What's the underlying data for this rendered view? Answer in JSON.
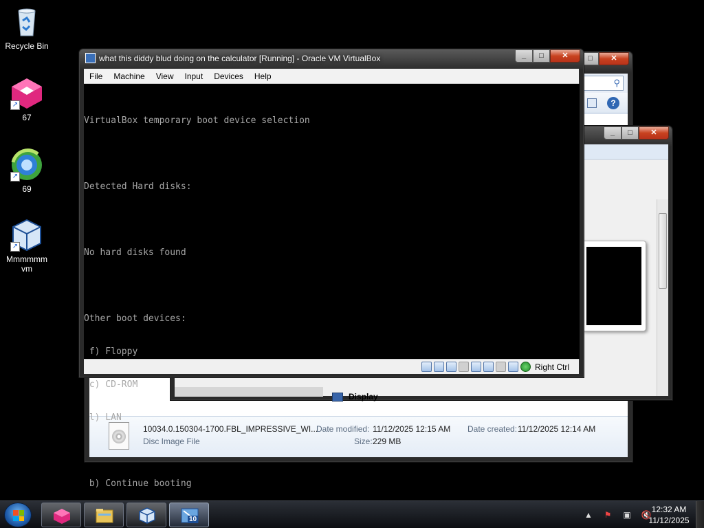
{
  "desktop": {
    "icons": [
      {
        "label": "Recycle Bin",
        "icon": "recycle-bin-icon"
      },
      {
        "label": "67",
        "icon": "pink-app-icon"
      },
      {
        "label": "69",
        "icon": "globe-app-icon"
      },
      {
        "label": "Mmmmmm vm",
        "icon": "virtualbox-icon"
      }
    ]
  },
  "explorer": {
    "file_name": "10034.0.150304-1700.FBL_IMPRESSIVE_WI...",
    "file_type": "Disc Image File",
    "date_modified_label": "Date modified:",
    "date_modified": "11/12/2025 12:15 AM",
    "date_created_label": "Date created:",
    "date_created": "11/12/2025 12:14 AM",
    "size_label": "Size:",
    "size": "229 MB"
  },
  "settings": {
    "display_label": "Display"
  },
  "vbox": {
    "title": "what this diddy blud doing on the calculator [Running] - Oracle VM VirtualBox",
    "menu": [
      "File",
      "Machine",
      "View",
      "Input",
      "Devices",
      "Help"
    ],
    "screen_lines": [
      "VirtualBox temporary boot device selection",
      "",
      "Detected Hard disks:",
      "",
      "No hard disks found",
      "",
      "Other boot devices:",
      " f) Floppy",
      " c) CD-ROM",
      " l) LAN",
      "",
      " b) Continue booting"
    ],
    "host_key": "Right Ctrl"
  },
  "taskbar": {
    "time": "12:32 AM",
    "date": "11/12/2025",
    "badge": "10"
  },
  "colors": {
    "desktop_bg": "#000000",
    "console_text": "#a8a8a8",
    "close_red": "#c8421f"
  }
}
